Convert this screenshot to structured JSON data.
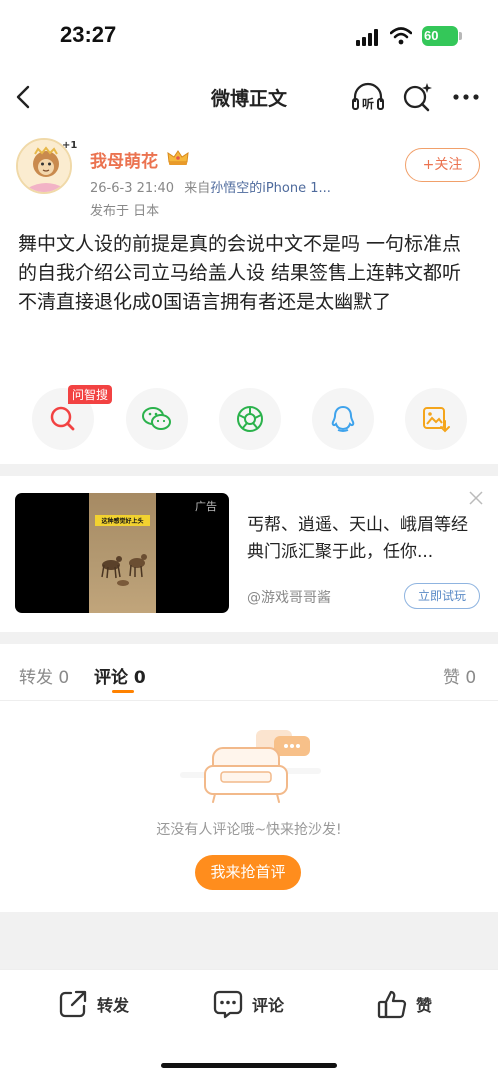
{
  "status_bar": {
    "time": "23:27",
    "battery": "60"
  },
  "nav": {
    "title": "微博正文",
    "listen_label": "听"
  },
  "post": {
    "author": "我母萌花",
    "avatar_badge": "+1",
    "date": "26-6-3 21:40",
    "source_prefix": "来自",
    "source": "孙悟空的iPhone 1...",
    "location": "发布于 日本",
    "follow_label": "+关注",
    "body": "舞中文人设的前提是真的会说中文不是吗 一句标准点的自我介绍公司立马给盖人设 结果签售上连韩文都听不清直接退化成0国语言拥有者还是太幽默了"
  },
  "share": {
    "ask_badge": "问智搜",
    "items": [
      "search-ask-icon",
      "wechat-icon",
      "moments-icon",
      "qq-icon",
      "save-image-icon"
    ]
  },
  "ad": {
    "tag": "广告",
    "thumb_caption": "这种感觉好上头",
    "text": "丐帮、逍遥、天山、峨眉等经典门派汇聚于此，任你...",
    "source": "@游戏哥哥酱",
    "cta": "立即试玩"
  },
  "tabs": {
    "repost": "转发 0",
    "comment": "评论 0",
    "like": "赞 0"
  },
  "empty": {
    "text": "还没有人评论哦~快来抢沙发!",
    "button": "我来抢首评"
  },
  "bottom": {
    "repost": "转发",
    "comment": "评论",
    "like": "赞"
  },
  "colors": {
    "accent": "#ff8200",
    "username": "#eb7350",
    "link": "#4e6a9c"
  }
}
